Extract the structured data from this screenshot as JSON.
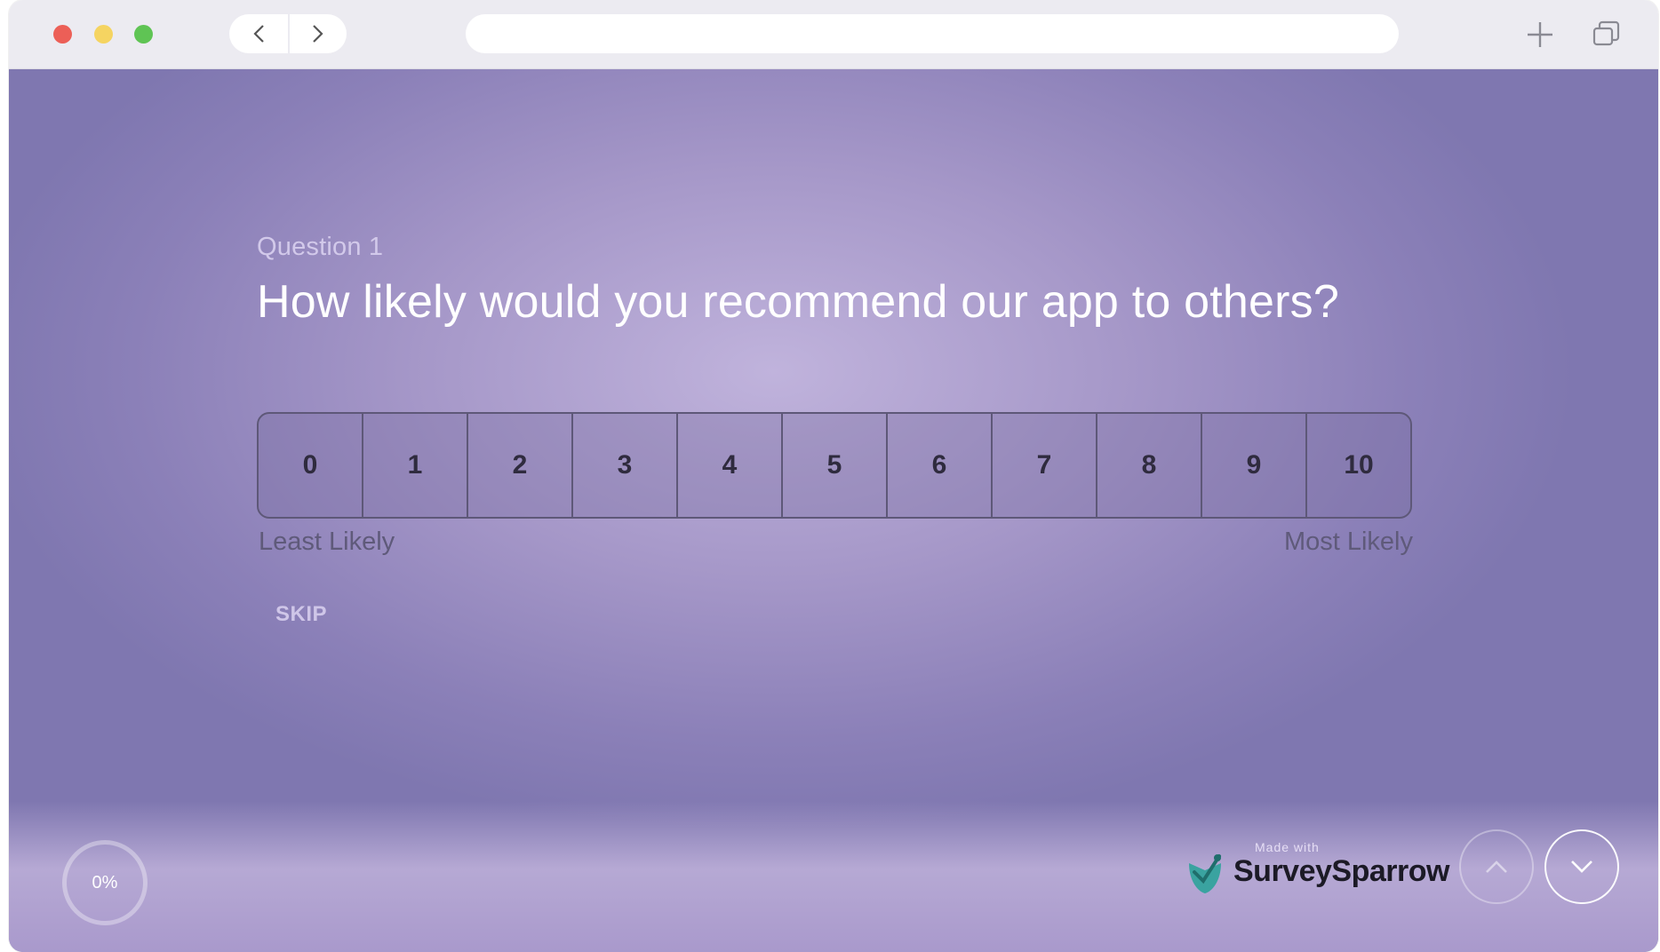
{
  "browser": {
    "address_value": "",
    "icons": [
      "back-chevron-icon",
      "forward-chevron-icon",
      "new-tab-plus-icon",
      "tabs-overview-icon"
    ]
  },
  "question": {
    "number_label": "Question 1",
    "title": "How likely would you recommend our app to others?"
  },
  "scale": {
    "options": [
      "0",
      "1",
      "2",
      "3",
      "4",
      "5",
      "6",
      "7",
      "8",
      "9",
      "10"
    ],
    "min_label": "Least Likely",
    "max_label": "Most Likely"
  },
  "actions": {
    "skip_label": "SKIP"
  },
  "footer": {
    "progress_text": "0%",
    "branding_prefix": "Made with",
    "branding_name": "SurveySparrow"
  },
  "colors": {
    "background_center": "#c0b3dc",
    "background_edge": "#7f77b0",
    "question_title": "#ffffff",
    "scale_border": "#5e5878",
    "brand_teal": "#3aa3a0"
  }
}
